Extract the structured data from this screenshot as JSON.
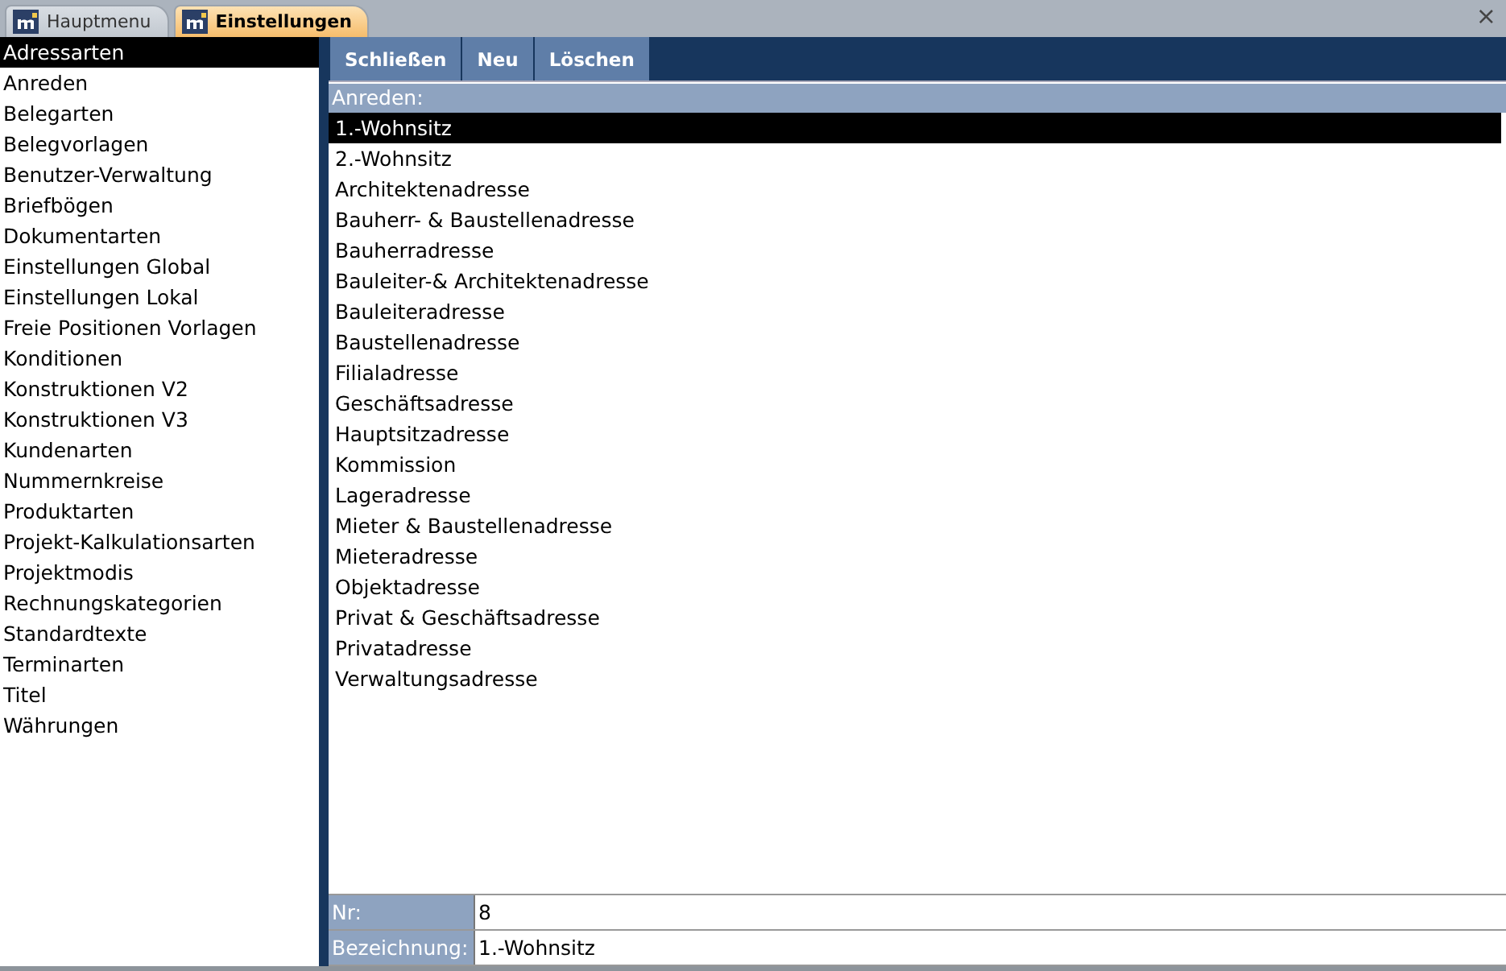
{
  "tabs": [
    {
      "label": "Hauptmenu",
      "selected": false
    },
    {
      "label": "Einstellungen",
      "selected": true
    }
  ],
  "close_icon": "×",
  "sidebar": {
    "items": [
      {
        "label": "Adressarten",
        "selected": true
      },
      {
        "label": "Anreden",
        "selected": false
      },
      {
        "label": "Belegarten",
        "selected": false
      },
      {
        "label": "Belegvorlagen",
        "selected": false
      },
      {
        "label": "Benutzer-Verwaltung",
        "selected": false
      },
      {
        "label": "Briefbögen",
        "selected": false
      },
      {
        "label": "Dokumentarten",
        "selected": false
      },
      {
        "label": "Einstellungen Global",
        "selected": false
      },
      {
        "label": "Einstellungen Lokal",
        "selected": false
      },
      {
        "label": "Freie Positionen Vorlagen",
        "selected": false
      },
      {
        "label": "Konditionen",
        "selected": false
      },
      {
        "label": "Konstruktionen V2",
        "selected": false
      },
      {
        "label": "Konstruktionen V3",
        "selected": false
      },
      {
        "label": "Kundenarten",
        "selected": false
      },
      {
        "label": "Nummernkreise",
        "selected": false
      },
      {
        "label": "Produktarten",
        "selected": false
      },
      {
        "label": "Projekt-Kalkulationsarten",
        "selected": false
      },
      {
        "label": "Projektmodis",
        "selected": false
      },
      {
        "label": "Rechnungskategorien",
        "selected": false
      },
      {
        "label": "Standardtexte",
        "selected": false
      },
      {
        "label": "Terminarten",
        "selected": false
      },
      {
        "label": "Titel",
        "selected": false
      },
      {
        "label": "Währungen",
        "selected": false
      }
    ]
  },
  "toolbar": {
    "buttons": [
      "Schließen",
      "Neu",
      "Löschen"
    ]
  },
  "list": {
    "header": "Anreden:",
    "items": [
      {
        "label": "1.-Wohnsitz",
        "selected": true
      },
      {
        "label": "2.-Wohnsitz",
        "selected": false
      },
      {
        "label": "Architektenadresse",
        "selected": false
      },
      {
        "label": "Bauherr- & Baustellenadresse",
        "selected": false
      },
      {
        "label": "Bauherradresse",
        "selected": false
      },
      {
        "label": "Bauleiter-& Architektenadresse",
        "selected": false
      },
      {
        "label": "Bauleiteradresse",
        "selected": false
      },
      {
        "label": "Baustellenadresse",
        "selected": false
      },
      {
        "label": "Filialadresse",
        "selected": false
      },
      {
        "label": "Geschäftsadresse",
        "selected": false
      },
      {
        "label": "Hauptsitzadresse",
        "selected": false
      },
      {
        "label": "Kommission",
        "selected": false
      },
      {
        "label": "Lageradresse",
        "selected": false
      },
      {
        "label": "Mieter & Baustellenadresse",
        "selected": false
      },
      {
        "label": "Mieteradresse",
        "selected": false
      },
      {
        "label": "Objektadresse",
        "selected": false
      },
      {
        "label": "Privat & Geschäftsadresse",
        "selected": false
      },
      {
        "label": "Privatadresse",
        "selected": false
      },
      {
        "label": "Verwaltungsadresse",
        "selected": false
      }
    ]
  },
  "fields": [
    {
      "label": "Nr:",
      "value": "8"
    },
    {
      "label": "Bezeichnung:",
      "value": "1.-Wohnsitz"
    }
  ]
}
